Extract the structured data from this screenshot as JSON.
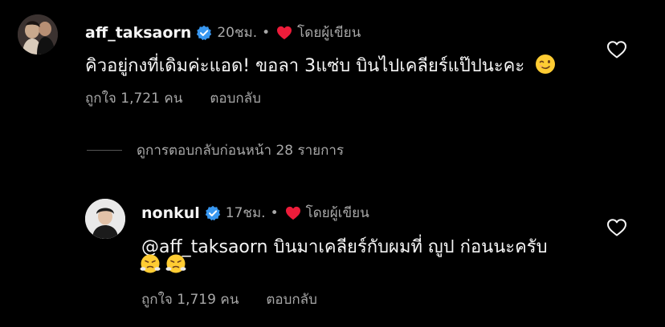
{
  "comments": [
    {
      "username": "aff_taksaorn",
      "time": "20ชม.",
      "separator": "•",
      "by_author": "โดยผู้เขียน",
      "text": "คิวอยู่กงที่เดิมค่ะแอด! ขอลา 3แซ่บ บินไปเคลียร์แป๊ปนะคะ",
      "emoji": "winking-face",
      "likes": "ถูกใจ 1,721 คน",
      "reply": "ตอบกลับ"
    },
    {
      "username": "nonkul",
      "time": "17ชม.",
      "separator": "•",
      "by_author": "โดยผู้เขียน",
      "text": "@aff_taksaorn บินมาเคลียร์กับผมที่ ญูป ก่อนนะครับ",
      "emojis": [
        "face-with-steam",
        "face-with-steam"
      ],
      "likes": "ถูกใจ 1,719 คน",
      "reply": "ตอบกลับ"
    }
  ],
  "view_replies": "ดูการตอบกลับก่อนหน้า 28 รายการ",
  "colors": {
    "background": "#000000",
    "text": "#f5f5f5",
    "muted": "#a8a8a8",
    "verified": "#3897f0",
    "heart": "#ed1c3a"
  }
}
